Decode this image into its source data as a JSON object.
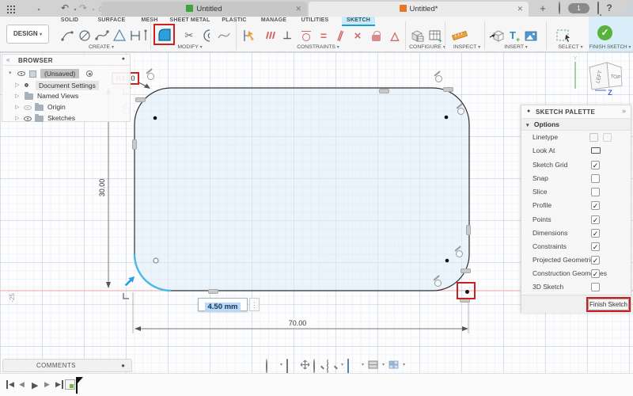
{
  "titlebar": {
    "doc_tabs": [
      {
        "label": "Untitled"
      },
      {
        "label": "Untitled*"
      }
    ],
    "job_count": "1"
  },
  "ribbon": {
    "design_label": "DESIGN",
    "tabs": [
      "SOLID",
      "SURFACE",
      "MESH",
      "SHEET METAL",
      "PLASTIC",
      "MANAGE",
      "UTILITIES",
      "SKETCH"
    ],
    "groups": {
      "create": "CREATE",
      "modify": "MODIFY",
      "constraints": "CONSTRAINTS",
      "configure": "CONFIGURE",
      "inspect": "INSPECT",
      "insert": "INSERT",
      "select": "SELECT",
      "finish": "FINISH SKETCH"
    }
  },
  "browser": {
    "title": "BROWSER",
    "root_label": "(Unsaved)",
    "items": [
      "Document Settings",
      "Named Views",
      "Origin",
      "Sketches"
    ]
  },
  "canvas": {
    "radius_dim": "R4.50",
    "height_dim": "30.00",
    "width_dim": "70.00",
    "axis_tick": "-25",
    "input_value": "4.50 mm",
    "viewcube": {
      "left_face": "LEFT",
      "top_face": "TOP",
      "z_axis": "Z",
      "y_axis": "Y"
    }
  },
  "palette": {
    "title": "SKETCH PALETTE",
    "section_label": "Options",
    "rows": [
      {
        "label": "Linetype",
        "check": null
      },
      {
        "label": "Look At",
        "check": null
      },
      {
        "label": "Sketch Grid",
        "check": "✓"
      },
      {
        "label": "Snap",
        "check": ""
      },
      {
        "label": "Slice",
        "check": ""
      },
      {
        "label": "Profile",
        "check": "✓"
      },
      {
        "label": "Points",
        "check": "✓"
      },
      {
        "label": "Dimensions",
        "check": "✓"
      },
      {
        "label": "Constraints",
        "check": "✓"
      },
      {
        "label": "Projected Geometries",
        "check": "✓"
      },
      {
        "label": "Construction Geometries",
        "check": "✓"
      },
      {
        "label": "3D Sketch",
        "check": ""
      }
    ],
    "finish_button_label": "Finish Sketch"
  },
  "comments": {
    "title": "COMMENTS"
  },
  "icons": {
    "caret": "▾",
    "tree_open": "▾",
    "tree_closed": "▷",
    "dot": "●",
    "collapse_left": "«",
    "collapse_right": "»",
    "close": "✕",
    "plus": "+",
    "home": "⌂",
    "undo": "↶",
    "redo": "↷",
    "question": "?",
    "kebab": "⋮",
    "scissors": "✂",
    "perpendicular": "⊥",
    "equal": "=",
    "parallel": "∥",
    "cross": "×",
    "triangle": "△",
    "check": "✓",
    "play": "▶",
    "back": "◀",
    "insert_t": "T",
    "insert_plus": "+"
  },
  "colors": {
    "accent_blue": "#1a9fd5",
    "selection_red": "#cc2020",
    "fillet_blue": "#2ba0da",
    "finish_green": "#59b23c",
    "axis_red": "#e6a9a9",
    "sketch_fill": "#dcebf7",
    "sketch_line": "#2f2f2f",
    "highlight_cyan": "#49b8e8"
  }
}
